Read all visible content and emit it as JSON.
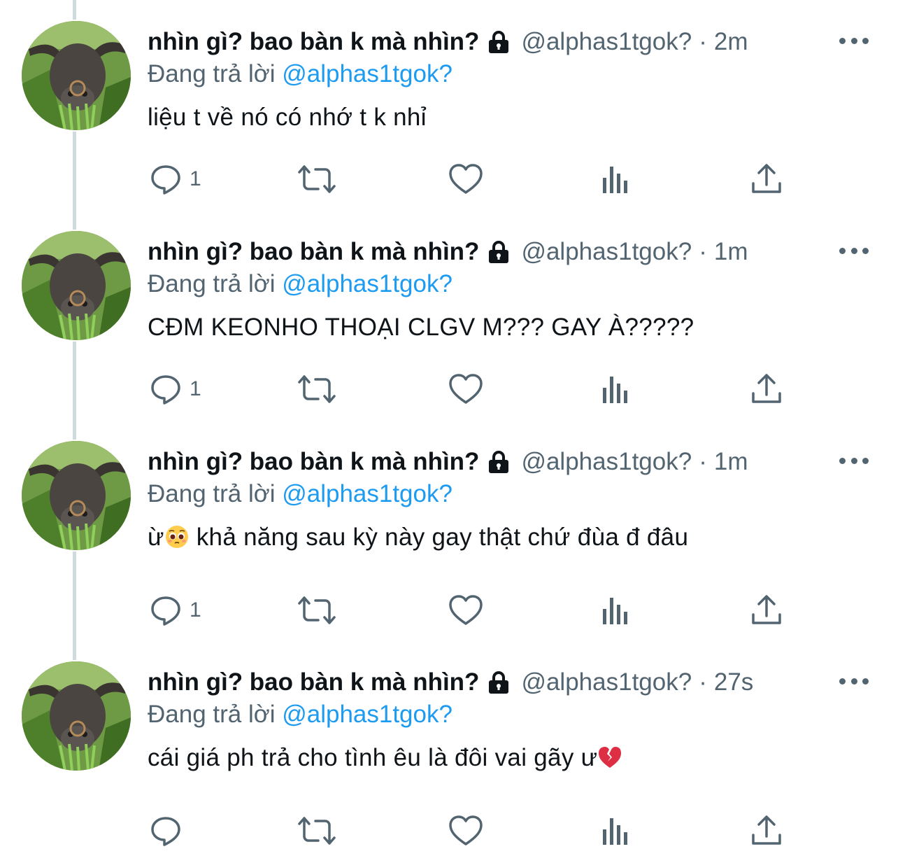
{
  "colors": {
    "accent": "#1d9bf0",
    "muted": "#536471",
    "text": "#0f1419",
    "thread_line": "#cfd9de"
  },
  "tweets": [
    {
      "name": "nhìn gì? bao bàn k mà nhìn?",
      "handle": "@alphas1tgok?",
      "separator": "·",
      "time": "2m",
      "reply_prefix": "Đang trả lời",
      "reply_handle": "@alphas1tgok?",
      "text": "liệu t về nó có nhớ t k nhỉ",
      "text_emoji": "",
      "reply_count": "1"
    },
    {
      "name": "nhìn gì? bao bàn k mà nhìn?",
      "handle": "@alphas1tgok?",
      "separator": "·",
      "time": "1m",
      "reply_prefix": "Đang trả lời",
      "reply_handle": "@alphas1tgok?",
      "text": "CĐM KEONHO THOẠI CLGV M??? GAY À?????",
      "text_emoji": "",
      "reply_count": "1"
    },
    {
      "name": "nhìn gì? bao bàn k mà nhìn?",
      "handle": "@alphas1tgok?",
      "separator": "·",
      "time": "1m",
      "reply_prefix": "Đang trả lời",
      "reply_handle": "@alphas1tgok?",
      "text": "ừ",
      "text_emoji": "pleading-face-emoji",
      "text_after": " khả năng sau kỳ này gay thật chứ đùa đ đâu",
      "reply_count": "1"
    },
    {
      "name": "nhìn gì? bao bàn k mà nhìn?",
      "handle": "@alphas1tgok?",
      "separator": "·",
      "time": "27s",
      "reply_prefix": "Đang trả lời",
      "reply_handle": "@alphas1tgok?",
      "text": "cái giá ph trả cho tình êu là đôi vai gãy ư",
      "text_emoji": "broken-heart-emoji",
      "reply_count": ""
    }
  ],
  "icons": {
    "lock": "lock-icon",
    "more": "more-icon",
    "reply": "reply-icon",
    "retweet": "retweet-icon",
    "like": "like-icon",
    "views": "views-icon",
    "share": "share-icon"
  }
}
